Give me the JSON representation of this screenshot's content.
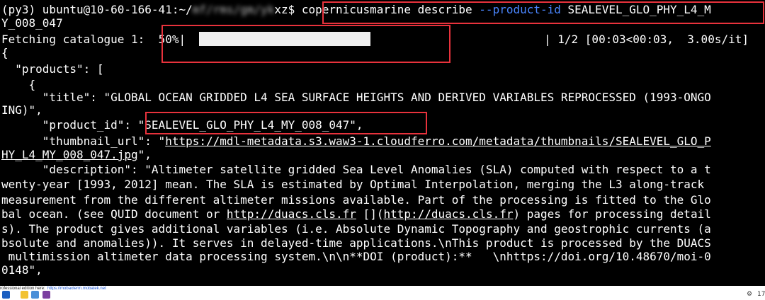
{
  "terminal": {
    "line1_prompt_a": "(py3) ubuntu@10-60-166-41:~/",
    "line1_prompt_redacted": "mf/rms/gm/yk",
    "line1_prompt_b": "xz$ ",
    "line1_cmd_a": "copernicusmarine describe ",
    "line1_cmd_flag": "--product-id",
    "line1_cmd_b": " SEALEVEL_GLO_PHY_L4_M",
    "line2": "Y_008_047",
    "line3_a": "Fetching catalogue 1:  ",
    "line3_pct": "50%|",
    "line3_tail": "| 1/2 [00:03<00:03,  3.00s/it]",
    "line4": "{",
    "line5": "  \"products\": [",
    "line6": "    {",
    "line7": "      \"title\": \"GLOBAL OCEAN GRIDDED L4 SEA SURFACE HEIGHTS AND DERIVED VARIABLES REPROCESSED (1993-ONGO",
    "line8": "ING)\",",
    "line9_key": "      \"product_id\": ",
    "line9_val": "\"SEALEVEL_GLO_PHY_L4_MY_008_047\",",
    "line10_key": "      \"thumbnail_url\": \"",
    "line10_link": "https://mdl-metadata.s3.waw3-1.cloudferro.com/metadata/thumbnails/SEALEVEL_GLO_P",
    "line11_link": "HY_L4_MY_008_047.jpg",
    "line11_end": "\",",
    "line12": "      \"description\": \"Altimeter satellite gridded Sea Level Anomalies (SLA) computed with respect to a t",
    "line13": "wenty-year [1993, 2012] mean. The SLA is estimated by Optimal Interpolation, merging the L3 along-track",
    "line14": "measurement from the different altimeter missions available. Part of the processing is fitted to the Glo",
    "line15_a": "bal ocean. (see QUID document or ",
    "line15_link1": "http://duacs.cls.fr",
    "line15_b": " [](",
    "line15_link2": "http://duacs.cls.fr",
    "line15_c": ") pages for processing detail",
    "line16": "s). The product gives additional variables (i.e. Absolute Dynamic Topography and geostrophic currents (a",
    "line17": "bsolute and anomalies)). It serves in delayed-time applications.\\nThis product is processed by the DUACS",
    "line18": " multimission altimeter data processing system.\\n\\n**DOI (product):**   \\nhttps://doi.org/10.48670/moi-0",
    "line19": "0148\","
  },
  "progress": {
    "fraction": 0.5
  },
  "statusbar": {
    "ad_text": "rofessional edition here:  ",
    "ad_link": "https://mobaxterm.mobatek.net",
    "tray_number": "17"
  },
  "colors": {
    "highlight_box": "#e8323c",
    "link": "#1a55d6"
  },
  "icons": [
    "start-icon",
    "folder-icon",
    "files-icon",
    "app-icon",
    "settings-icon"
  ]
}
